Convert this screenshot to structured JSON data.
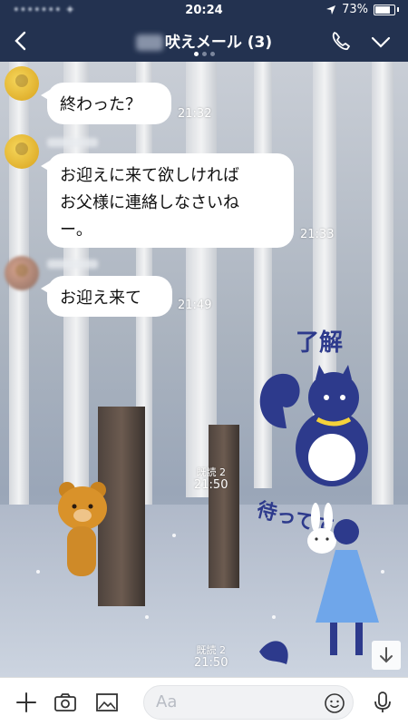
{
  "status": {
    "time": "20:24",
    "battery": "73%"
  },
  "header": {
    "title": "吠えメール (3)",
    "page_dots": 3,
    "active_dot": 0
  },
  "messages": [
    {
      "text": "終わった？",
      "time": "21:32"
    },
    {
      "text": "お迎えに来て欲しければ\nお父様に連絡しなさいね\nー。",
      "time": "21:33"
    },
    {
      "text": "お迎え来て",
      "time": "21:49"
    }
  ],
  "stickers": [
    {
      "read": "既読 2",
      "time": "21:50",
      "caption": "了解"
    },
    {
      "read": "既読 2",
      "time": "21:50",
      "caption": "待ってて"
    }
  ],
  "input": {
    "placeholder": "Aa"
  },
  "colors": {
    "header": "#233250",
    "bubble": "#ffffff",
    "accent": "#2d3a8c"
  }
}
